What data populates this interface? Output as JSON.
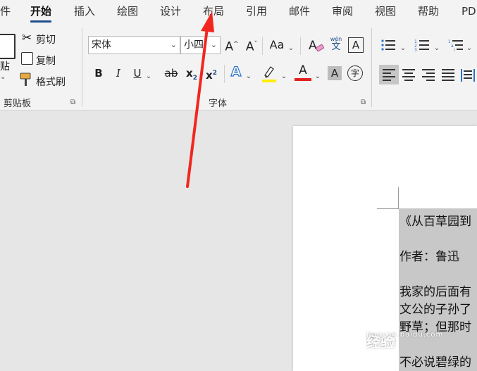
{
  "tabs": [
    {
      "id": "file",
      "label": "件"
    },
    {
      "id": "home",
      "label": "开始",
      "active": true
    },
    {
      "id": "insert",
      "label": "插入"
    },
    {
      "id": "draw",
      "label": "绘图"
    },
    {
      "id": "design",
      "label": "设计"
    },
    {
      "id": "layout",
      "label": "布局"
    },
    {
      "id": "references",
      "label": "引用"
    },
    {
      "id": "mailings",
      "label": "邮件"
    },
    {
      "id": "review",
      "label": "审阅"
    },
    {
      "id": "view",
      "label": "视图"
    },
    {
      "id": "help",
      "label": "帮助"
    },
    {
      "id": "pdf",
      "label": "PD"
    }
  ],
  "clipboard": {
    "paste_label": "贴",
    "cut_label": "剪切",
    "copy_label": "复制",
    "format_painter_label": "格式刷",
    "group_label": "剪贴板"
  },
  "font": {
    "font_name": "宋体",
    "font_size": "小四",
    "group_label": "字体",
    "grow": "A",
    "shrink": "A",
    "change_case": "Aa",
    "bold": "B",
    "italic": "I",
    "underline": "U",
    "strikethrough": "ab",
    "subscript": "x",
    "superscript": "x",
    "sub_mark": "2",
    "sup_mark": "2",
    "text_effect": "A",
    "font_color": "A",
    "char_shading": "A",
    "enclose": "字",
    "phonetic_top": "wén",
    "phonetic_bottom": "文",
    "char_border": "A",
    "colors": {
      "font_color": "#e0211d",
      "highlight": "#ffee00",
      "accent": "#1f4e8c",
      "arrow": "#f1271f"
    }
  },
  "document": {
    "lines": [
      "《从百草园到",
      "作者：鲁迅",
      "我家的后面有",
      "文公的子孙了",
      "野草；但那时",
      "不必说碧绿的"
    ]
  },
  "watermark": {
    "brand": "Bai",
    "brand2": "经验",
    "sub": "jingyan.baidu.com"
  }
}
